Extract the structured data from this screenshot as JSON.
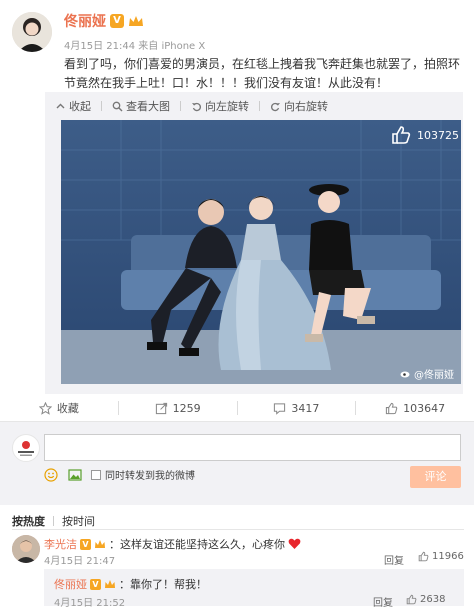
{
  "post": {
    "author": "佟丽娅",
    "verified_badge": "V",
    "meta": "4月15日 21:44 来自 iPhone X",
    "text": "看到了吗，你们喜爱的男演员，在红毯上拽着我飞奔赶集也就罢了，拍照环节竟然在我手上吐！口！水！！！我们没有友谊！从此没有！",
    "watermark": "@佟丽娅",
    "photo_like_count": "103725"
  },
  "media_toolbar": {
    "collapse": "收起",
    "view_large": "查看大图",
    "rotate_left": "向左旋转",
    "rotate_right": "向右旋转"
  },
  "actions": {
    "favorite": "收藏",
    "repost": "1259",
    "comment": "3417",
    "like": "103647"
  },
  "composer": {
    "repost_label": "同时转发到我的微博",
    "submit": "评论",
    "placeholder": ""
  },
  "sort": {
    "hot": "按热度",
    "time": "按时间"
  },
  "comments": [
    {
      "author": "李光洁",
      "text": "：这样友谊还能坚持这么久，心疼你",
      "time": "4月15日 21:47",
      "reply": "回复",
      "likes": "11966"
    }
  ],
  "reply": {
    "author": "佟丽娅",
    "text": "：靠你了！帮我！",
    "time": "4月15日 21:52",
    "reply": "回复",
    "likes": "2638"
  },
  "colors": {
    "author": "#eb7350",
    "badge": "#f6a623",
    "panel": "#f2f2f5",
    "submit": "#ffc09f"
  }
}
